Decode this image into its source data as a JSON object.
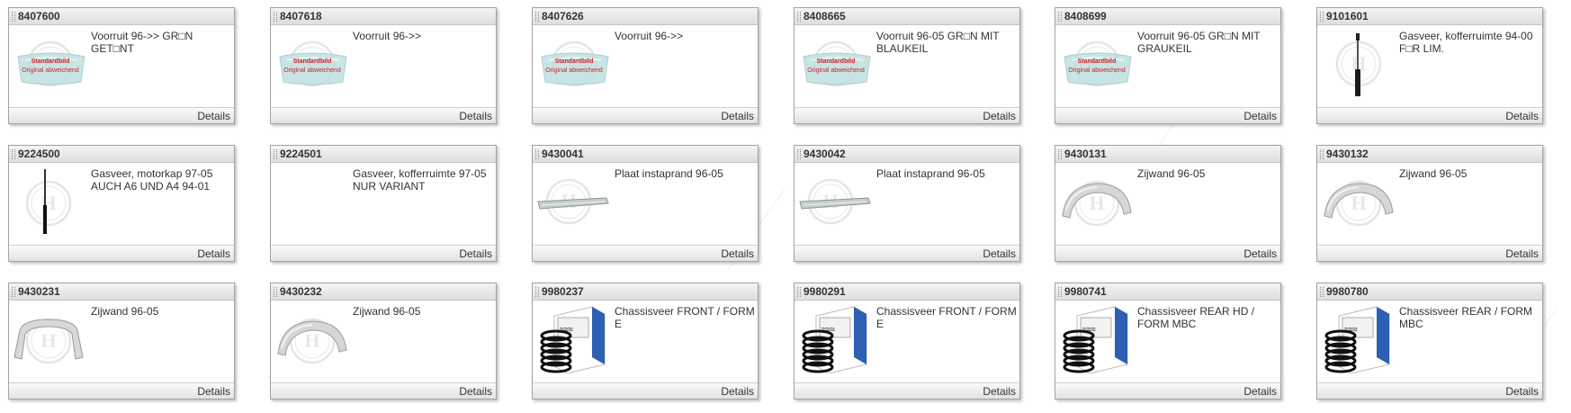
{
  "products": [
    {
      "article": "8407600",
      "description": "Voorruit 96->> GR□N GET□NT",
      "image": "windshield-placeholder",
      "stamp": {
        "line1": "Standardbild",
        "line2": "Original abweichend"
      }
    },
    {
      "article": "8407618",
      "description": "Voorruit 96->>",
      "image": "windshield-placeholder",
      "stamp": {
        "line1": "Standardbild",
        "line2": "Original abweichend"
      }
    },
    {
      "article": "8407626",
      "description": "Voorruit 96->>",
      "image": "windshield-placeholder",
      "stamp": {
        "line1": "Standardbild",
        "line2": "Original abweichend"
      }
    },
    {
      "article": "8408665",
      "description": "Voorruit 96-05 GR□N MIT BLAUKEIL",
      "image": "windshield-placeholder",
      "stamp": {
        "line1": "Standardbild",
        "line2": "Original abweichend"
      }
    },
    {
      "article": "8408699",
      "description": "Voorruit 96-05 GR□N MIT GRAUKEIL",
      "image": "windshield-placeholder",
      "stamp": {
        "line1": "Standardbild",
        "line2": "Original abweichend"
      }
    },
    {
      "article": "9101601",
      "description": "Gasveer, kofferruimte 94-00 F□R LIM.",
      "image": "gas-strut"
    },
    {
      "article": "9224500",
      "description": "Gasveer, motorkap 97-05 AUCH A6 UND A4 94-01",
      "image": "gas-strut-thin"
    },
    {
      "article": "9224501",
      "description": "Gasveer, kofferruimte 97-05 NUR VARIANT",
      "image": "none"
    },
    {
      "article": "9430041",
      "description": "Plaat instaprand 96-05",
      "image": "sill-panel"
    },
    {
      "article": "9430042",
      "description": "Plaat instaprand 96-05",
      "image": "sill-panel"
    },
    {
      "article": "9430131",
      "description": "Zijwand 96-05",
      "image": "wheel-arch-large"
    },
    {
      "article": "9430132",
      "description": "Zijwand 96-05",
      "image": "wheel-arch-small"
    },
    {
      "article": "9430231",
      "description": "Zijwand 96-05",
      "image": "wheel-arch-flat"
    },
    {
      "article": "9430232",
      "description": "Zijwand 96-05",
      "image": "wheel-arch-small"
    },
    {
      "article": "9980237",
      "description": "Chassisveer FRONT / FORM E",
      "image": "coil-spring-box"
    },
    {
      "article": "9980291",
      "description": "Chassisveer FRONT / FORM E",
      "image": "coil-spring-box"
    },
    {
      "article": "9980741",
      "description": "Chassisveer REAR HD / FORM MBC",
      "image": "coil-spring-box"
    },
    {
      "article": "9980780",
      "description": "Chassisveer REAR / FORM MBC",
      "image": "coil-spring-box"
    }
  ],
  "details_label": "Details"
}
